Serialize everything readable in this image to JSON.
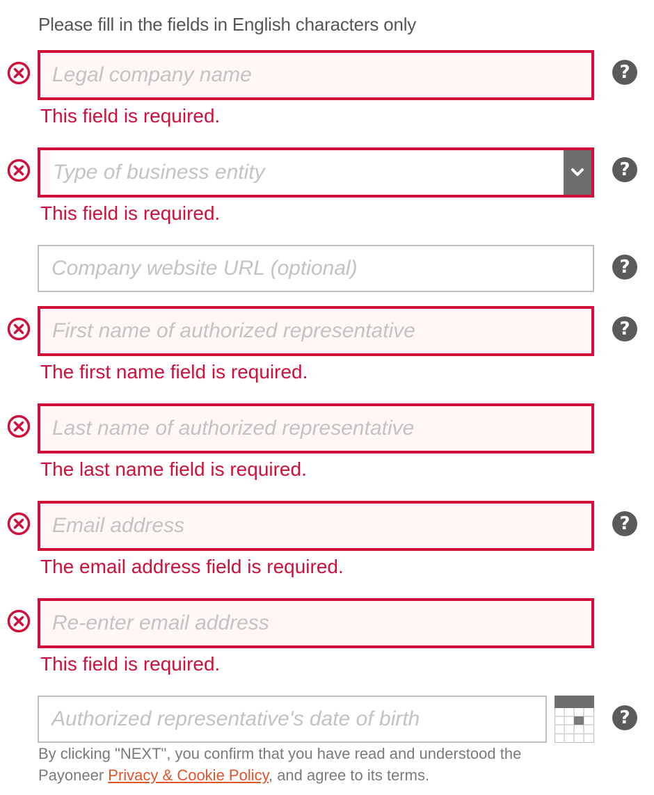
{
  "instruction": "Please fill in the fields in English characters only",
  "fields": {
    "legal_company_name": {
      "placeholder": "Legal company name",
      "error": "This field is required."
    },
    "business_entity_type": {
      "placeholder": "Type of business entity",
      "error": "This field is required."
    },
    "company_website": {
      "placeholder": "Company website URL (optional)"
    },
    "first_name": {
      "placeholder": "First name of authorized representative",
      "error": "The first name field is required."
    },
    "last_name": {
      "placeholder": "Last name of authorized representative",
      "error": "The last name field is required."
    },
    "email": {
      "placeholder": "Email address",
      "error": "The email address field is required."
    },
    "email_confirm": {
      "placeholder": "Re-enter email address",
      "error": "This field is required."
    },
    "date_of_birth": {
      "placeholder": "Authorized representative's date of birth"
    }
  },
  "help_icon_text": "?",
  "consent": {
    "prefix": "By clicking \"NEXT\", you confirm that you have read and understood the Payoneer ",
    "link_text": "Privacy & Cookie Policy",
    "suffix": ", and agree to its terms."
  },
  "colors": {
    "error": "#d0103a",
    "error_bg": "#fff6f6",
    "border": "#bdbdbd",
    "help_icon": "#5a5a5a",
    "link": "#e0542a"
  },
  "icons": {
    "error": "error-circle-x-icon",
    "help": "question-mark-icon",
    "dropdown": "chevron-down-icon",
    "calendar": "calendar-icon"
  }
}
